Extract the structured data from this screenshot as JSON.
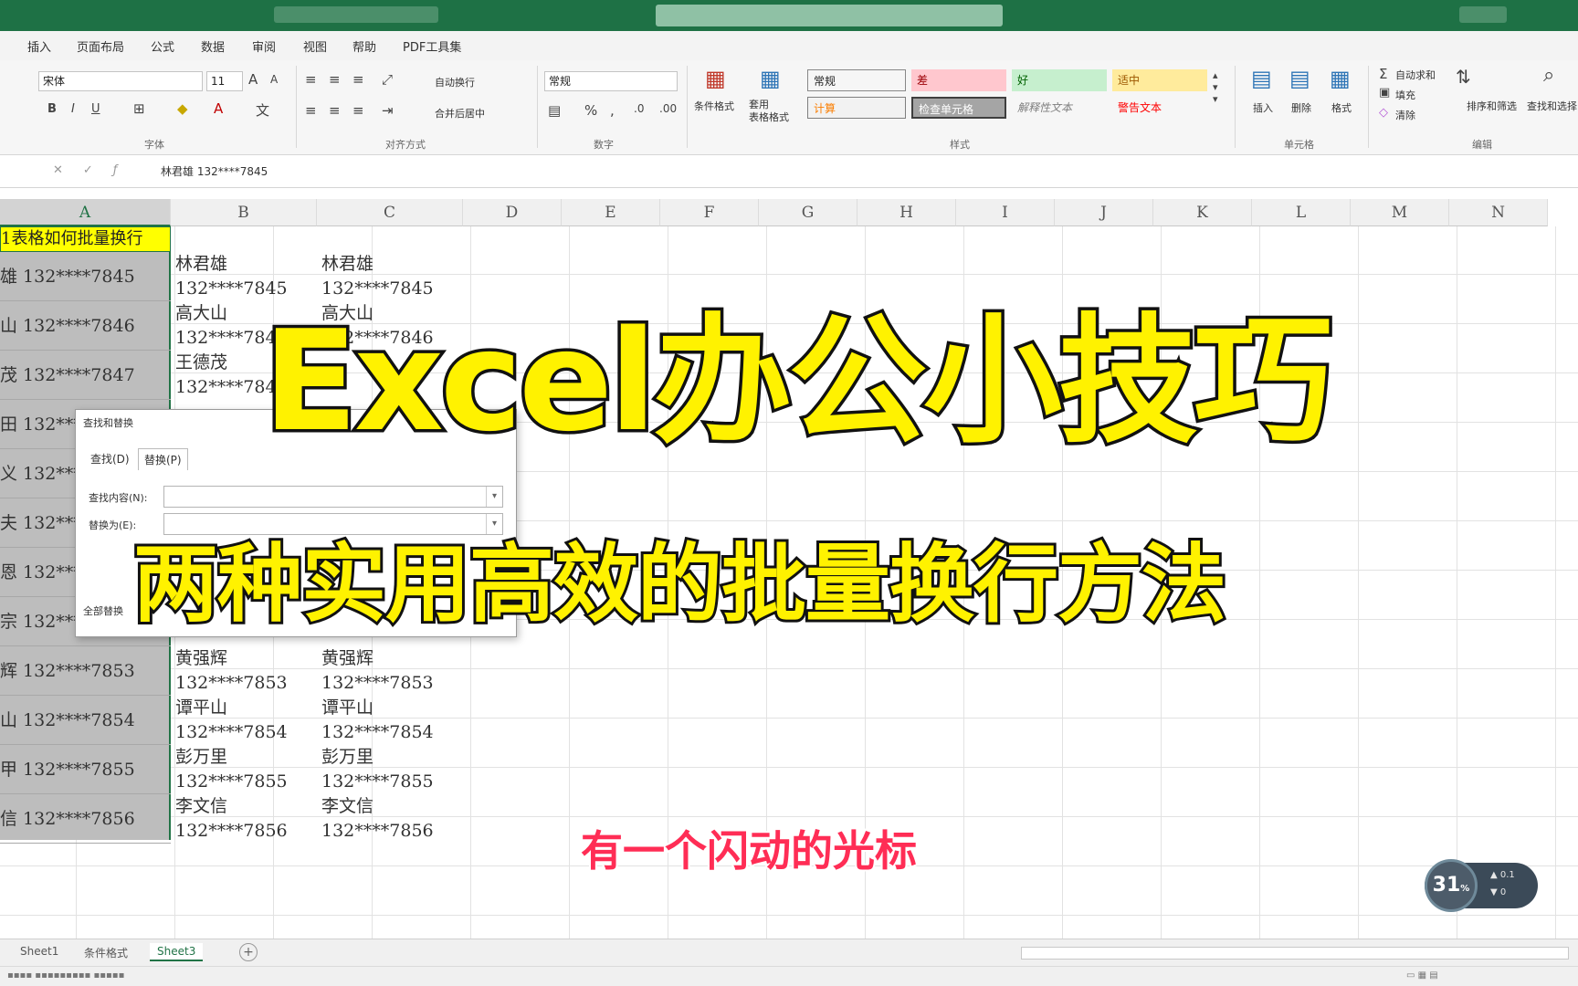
{
  "ribbon": {
    "tabs": [
      "插入",
      "页面布局",
      "公式",
      "数据",
      "审阅",
      "视图",
      "帮助",
      "PDF工具集"
    ],
    "font": {
      "name": "宋体",
      "size": "11",
      "group_label": "字体"
    },
    "alignment": {
      "wrap_text": "自动换行",
      "merge_center": "合并后居中",
      "group_label": "对齐方式"
    },
    "number": {
      "format": "常规",
      "group_label": "数字"
    },
    "styles": {
      "conditional_format": "条件格式",
      "table_format": "套用\n表格格式",
      "cells": [
        {
          "label": "常规",
          "bg": "#ffffff",
          "color": "#222222"
        },
        {
          "label": "差",
          "bg": "#ffc7ce",
          "color": "#9c0006"
        },
        {
          "label": "好",
          "bg": "#c6efce",
          "color": "#006100"
        },
        {
          "label": "适中",
          "bg": "#ffeb9c",
          "color": "#9c5700"
        },
        {
          "label": "计算",
          "bg": "#f2f2f2",
          "color": "#fa7d00"
        },
        {
          "label": "检查单元格",
          "bg": "#a5a5a5",
          "color": "#ffffff"
        },
        {
          "label": "解释性文本",
          "bg": "#ffffff",
          "color": "#7f7f7f"
        },
        {
          "label": "警告文本",
          "bg": "#ffffff",
          "color": "#ff0000"
        }
      ],
      "group_label": "样式"
    },
    "cells_group": {
      "insert": "插入",
      "delete": "删除",
      "format": "格式",
      "group_label": "单元格"
    },
    "editing": {
      "autosum": "自动求和",
      "fill": "填充",
      "clear": "清除",
      "sort_filter": "排序和筛选",
      "find_select": "查找和选择",
      "group_label": "编辑"
    }
  },
  "formula_bar": {
    "content": "林君雄 132****7845"
  },
  "columns": [
    "A",
    "B",
    "C",
    "D",
    "E",
    "F",
    "G",
    "H",
    "I",
    "J",
    "K",
    "L",
    "M",
    "N"
  ],
  "sheet": {
    "a1": "1表格如何批量换行",
    "column_a_rows": [
      "雄 132****7845",
      "山 132****7846",
      "茂 132****7847",
      "田 132****7848",
      "义 132****7849",
      "夫 132****7850",
      "恩 132****7851",
      "宗 132****7852",
      "辉 132****7853",
      "山 132****7854",
      "甲 132****7855",
      "信 132****7856"
    ],
    "wrapped_rows": [
      {
        "b": "林君雄\n132****7845",
        "c": "林君雄\n132****7845"
      },
      {
        "b": "高大山\n132****7846",
        "c": "高大山\n132****7846"
      },
      {
        "b": "王德茂\n132****7847",
        "c": ""
      },
      {
        "b": "黄强辉\n132****7853",
        "c": "黄强辉\n132****7853"
      },
      {
        "b": "谭平山\n132****7854",
        "c": "谭平山\n132****7854"
      },
      {
        "b": "彭万里\n132****7855",
        "c": "彭万里\n132****7855"
      },
      {
        "b": "李文信\n132****7856",
        "c": "李文信\n132****7856"
      }
    ]
  },
  "dialog": {
    "title": "查找和替换",
    "tab_find": "查找(D)",
    "tab_replace": "替换(P)",
    "find_label": "查找内容(N):",
    "replace_label": "替换为(E):",
    "replace_all": "全部替换"
  },
  "overlay": {
    "title": "Excel办公小技巧",
    "subtitle": "两种实用高效的批量换行方法",
    "caption": "有一个闪动的光标"
  },
  "speed_widget": {
    "percent": "31",
    "unit": "%",
    "up": "0.1",
    "down": "0"
  },
  "sheet_tabs": [
    "Sheet1",
    "条件格式",
    "Sheet3"
  ],
  "active_sheet": "Sheet3",
  "colors": {
    "excel_green": "#217346",
    "title_yellow": "#fff200",
    "caption_pink": "#ff2d55",
    "a1_fill": "#ffff00"
  }
}
